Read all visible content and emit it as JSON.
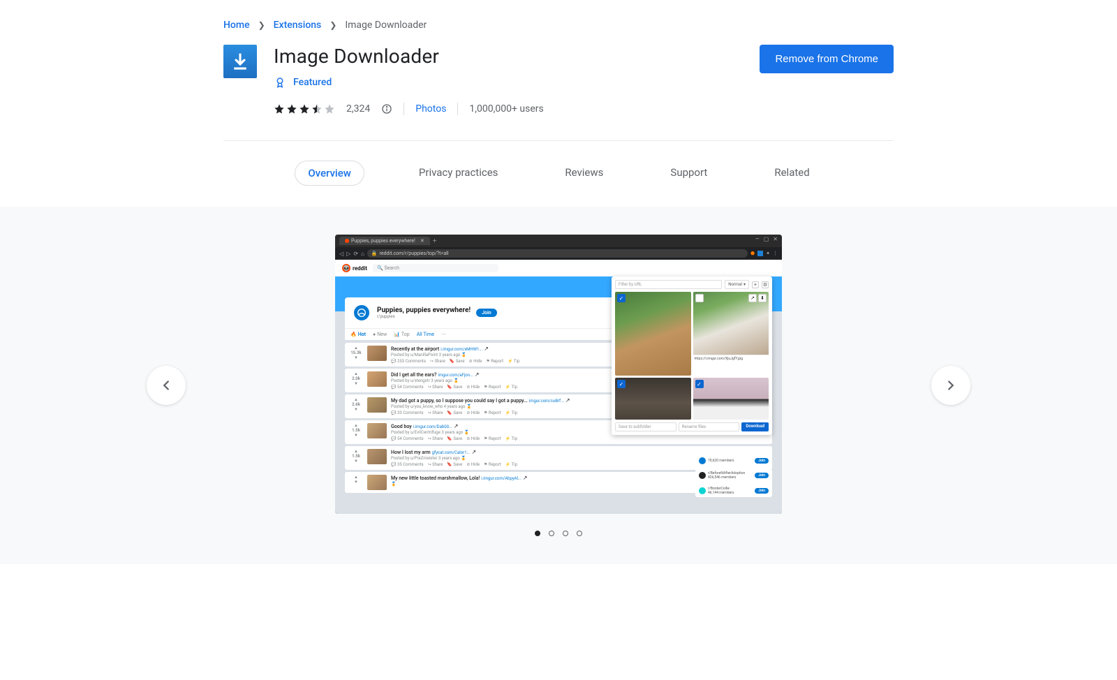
{
  "breadcrumb": {
    "home": "Home",
    "extensions": "Extensions",
    "current": "Image Downloader"
  },
  "header": {
    "title": "Image Downloader",
    "featured_label": "Featured",
    "rating_count": "2,324",
    "category": "Photos",
    "users": "1,000,000+ users",
    "remove_button": "Remove from Chrome",
    "stars": 3.5
  },
  "tabs": {
    "overview": "Overview",
    "privacy": "Privacy practices",
    "reviews": "Reviews",
    "support": "Support",
    "related": "Related"
  },
  "screenshot": {
    "tab_title": "Puppies, puppies everywhere!",
    "url": "reddit.com/r/puppies/top/?t=all",
    "reddit_label": "reddit",
    "search_placeholder": "Search",
    "sub_title": "Puppies, puppies everywhere!",
    "sub_name": "r/puppies",
    "join": "Join",
    "sort": {
      "hot": "Hot",
      "new": "New",
      "top": "Top",
      "alltime": "All Time"
    },
    "posts": [
      {
        "score": "15.3k",
        "title": "Recently at the airport",
        "link": "i.imgur.com/xMHW1...",
        "meta": "Posted by u/ManillaPoint 3 years ago",
        "comments": "253 Comments"
      },
      {
        "score": "2.0k",
        "title": "Did I get all the ears?",
        "link": "imgur.com/aFjon...",
        "meta": "Posted by u/stengstr 3 years ago",
        "comments": "54 Comments"
      },
      {
        "score": "2.6k",
        "title": "My dad got a puppy, so I suppose you could say I got a puppy...",
        "link": "imgur.com/cuBrf...",
        "meta": "Posted by u/you_know_who 4 years ago",
        "comments": "33 Comments"
      },
      {
        "score": "1.5k",
        "title": "Good boy",
        "link": "i.imgur.com/Dab00...",
        "meta": "Posted by u/EviICentrifuge 3 years ago",
        "comments": "54 Comments"
      },
      {
        "score": "1.5k",
        "title": "How I lost my arm",
        "link": "gfycat.com/Calor1...",
        "meta": "Posted by u/PreZmeister 3 years ago",
        "comments": "35 Comments"
      },
      {
        "score": "",
        "title": "My new little toasted marshmallow, Lola!",
        "link": "i.imgur.com/AbpyAl...",
        "meta": "",
        "comments": ""
      }
    ],
    "post_actions": {
      "share": "Share",
      "save": "Save",
      "hide": "Hide",
      "report": "Report",
      "tip": "Tip"
    },
    "popup": {
      "filter_placeholder": "Filter by URL",
      "mode": "Normal",
      "img_url": "https://i.imgur.com/XjuJgfY.jpg",
      "save_placeholder": "Save to subfolder",
      "rename_placeholder": "Rename files",
      "download": "Download"
    },
    "side": [
      {
        "name": "",
        "members": "70,620 members"
      },
      {
        "name": "r/BeforeNAfterAdoption",
        "members": "426,546 members"
      },
      {
        "name": "r/BorderCollie",
        "members": "46,144 members"
      }
    ]
  },
  "carousel": {
    "total": 4,
    "active": 0
  }
}
